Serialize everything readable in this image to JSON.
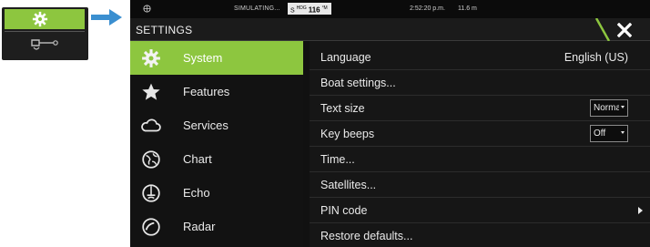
{
  "status": {
    "mode": "SIMULATING...",
    "heading_label": "S",
    "heading_sup": "HDG",
    "heading_value": "116",
    "heading_unit": "°M",
    "time": "2:52:20 p.m.",
    "depth": "11.6 m"
  },
  "window": {
    "title": "SETTINGS"
  },
  "menu": {
    "items": [
      {
        "label": "System",
        "icon": "gear-icon",
        "active": true
      },
      {
        "label": "Features",
        "icon": "star-icon",
        "active": false
      },
      {
        "label": "Services",
        "icon": "cloud-icon",
        "active": false
      },
      {
        "label": "Chart",
        "icon": "globe-icon",
        "active": false
      },
      {
        "label": "Echo",
        "icon": "echo-icon",
        "active": false
      },
      {
        "label": "Radar",
        "icon": "radar-icon",
        "active": false
      }
    ]
  },
  "settings": {
    "rows": [
      {
        "label": "Language",
        "value": "English (US)"
      },
      {
        "label": "Boat settings..."
      },
      {
        "label": "Text size",
        "value": "Normal"
      },
      {
        "label": "Key beeps",
        "value": "Off"
      },
      {
        "label": "Time..."
      },
      {
        "label": "Satellites..."
      },
      {
        "label": "PIN code"
      },
      {
        "label": "Restore defaults..."
      }
    ]
  },
  "colors": {
    "accent": "#8dc63f",
    "background": "#111111",
    "text": "#eaeaea"
  }
}
